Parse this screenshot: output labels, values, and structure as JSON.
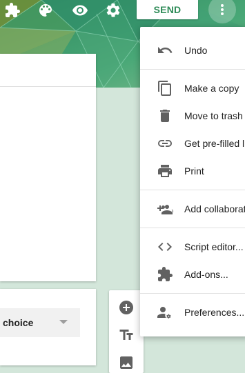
{
  "topbar": {
    "icons": [
      "puzzle-icon",
      "palette-icon",
      "eye-icon",
      "gear-icon"
    ],
    "send_label": "SEND",
    "more_icon": "more-vert-icon"
  },
  "menu": {
    "items": [
      {
        "label": "Undo",
        "icon": "undo-icon"
      },
      {
        "label": "Make a copy",
        "icon": "copy-icon"
      },
      {
        "label": "Move to trash",
        "icon": "trash-icon"
      },
      {
        "label": "Get pre-filled li",
        "icon": "link-icon"
      },
      {
        "label": "Print",
        "icon": "printer-icon"
      },
      {
        "label": "Add collaborat",
        "icon": "add-people-icon"
      },
      {
        "label": "Script editor...",
        "icon": "code-icon"
      },
      {
        "label": "Add-ons...",
        "icon": "puzzle-icon"
      },
      {
        "label": "Preferences...",
        "icon": "person-settings-icon"
      }
    ]
  },
  "question": {
    "type_label": "choice"
  },
  "toolbar": {
    "icons": [
      "add-circle-icon",
      "title-text-icon",
      "image-icon"
    ]
  },
  "colors": {
    "accent": "#2e8b57",
    "header_green": "#3d9a6c",
    "background": "#d3e6da",
    "icon_gray": "#616161"
  }
}
